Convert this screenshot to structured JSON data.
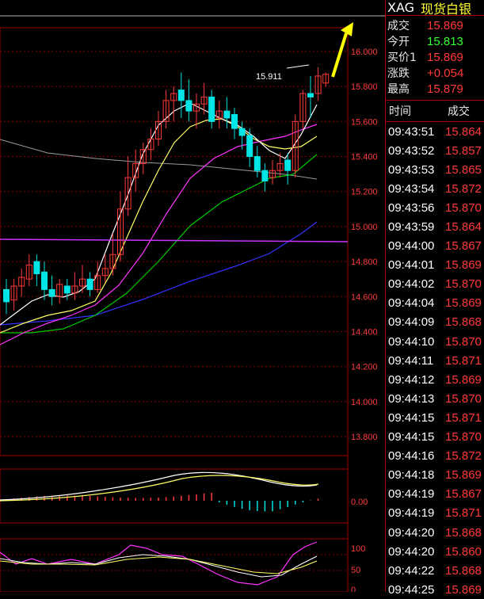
{
  "symbol": {
    "code": "XAG",
    "name": "现货白银"
  },
  "quote": [
    {
      "label": "成交",
      "value": "15.869",
      "color": "#ff3a3a"
    },
    {
      "label": "今开",
      "value": "15.813",
      "color": "#33ff33"
    },
    {
      "label": "买价1",
      "value": "15.869",
      "color": "#ff3a3a"
    },
    {
      "label": "涨跌",
      "value": "+0.054",
      "color": "#ff3a3a"
    },
    {
      "label": "最高",
      "value": "15.879",
      "color": "#ff3a3a"
    }
  ],
  "ticks_header": {
    "time": "时间",
    "price": "成交"
  },
  "ticks": [
    {
      "time": "09:43:51",
      "price": "15.864"
    },
    {
      "time": "09:43:52",
      "price": "15.857"
    },
    {
      "time": "09:43:53",
      "price": "15.865"
    },
    {
      "time": "09:43:54",
      "price": "15.872"
    },
    {
      "time": "09:43:56",
      "price": "15.870"
    },
    {
      "time": "09:43:59",
      "price": "15.864"
    },
    {
      "time": "09:44:00",
      "price": "15.867"
    },
    {
      "time": "09:44:01",
      "price": "15.869"
    },
    {
      "time": "09:44:02",
      "price": "15.870"
    },
    {
      "time": "09:44:04",
      "price": "15.869"
    },
    {
      "time": "09:44:09",
      "price": "15.868"
    },
    {
      "time": "09:44:10",
      "price": "15.870"
    },
    {
      "time": "09:44:11",
      "price": "15.871"
    },
    {
      "time": "09:44:12",
      "price": "15.869"
    },
    {
      "time": "09:44:13",
      "price": "15.870"
    },
    {
      "time": "09:44:15",
      "price": "15.871"
    },
    {
      "time": "09:44:15",
      "price": "15.870"
    },
    {
      "time": "09:44:16",
      "price": "15.872"
    },
    {
      "time": "09:44:18",
      "price": "15.869"
    },
    {
      "time": "09:44:19",
      "price": "15.867"
    },
    {
      "time": "09:44:19",
      "price": "15.871"
    },
    {
      "time": "09:44:20",
      "price": "15.868"
    },
    {
      "time": "09:44:20",
      "price": "15.860"
    },
    {
      "time": "09:44:22",
      "price": "15.868"
    },
    {
      "time": "09:44:25",
      "price": "15.869"
    }
  ],
  "chart": {
    "price_axis": [
      "16.000",
      "15.800",
      "15.600",
      "15.400",
      "15.200",
      "15.000",
      "14.800",
      "14.600",
      "14.400",
      "14.200",
      "14.000",
      "13.800"
    ],
    "peak_label": "15.911",
    "macd_axis": [
      "0.00"
    ],
    "kdj_axis": [
      "100",
      "50",
      "0"
    ],
    "colors": {
      "up": "#ff3a3a",
      "down": "#00e5e5",
      "ma5": "#ffffff",
      "ma10": "#ffff66",
      "ma20": "#ff33ff",
      "ma30": "#00cc00",
      "ma60": "#3333ff",
      "grid": "#8a0000",
      "arrow": "#ffff00"
    }
  }
}
